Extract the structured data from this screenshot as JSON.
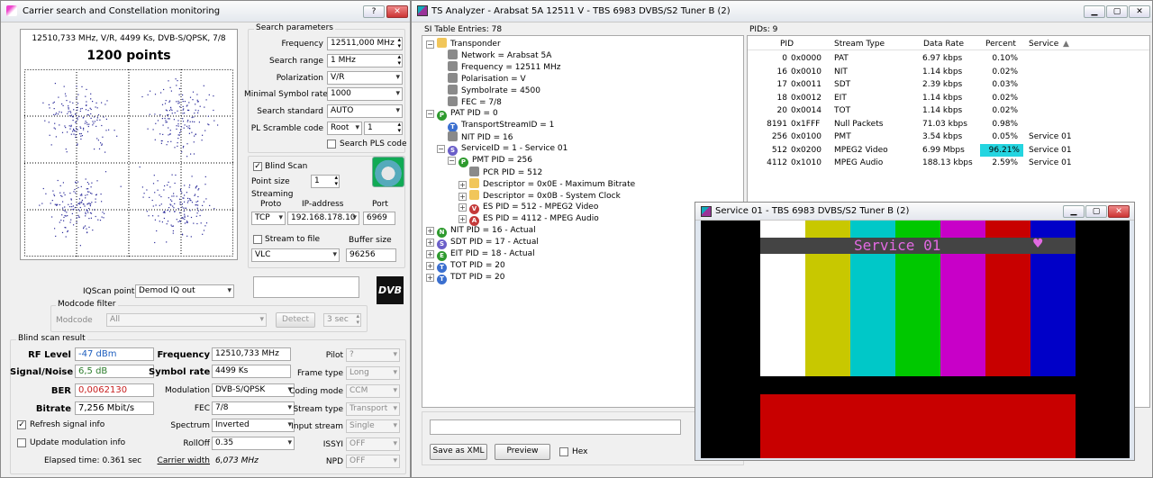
{
  "left": {
    "title": "Carrier search and Constellation monitoring",
    "constellation": {
      "info": "12510,733 MHz, V/R, 4499 Ks, DVB-S/QPSK, 7/8",
      "points": "1200 points"
    },
    "search": {
      "group": "Search parameters",
      "freq_label": "Frequency",
      "freq": "12511,000 MHz",
      "range_label": "Search range",
      "range": "1 MHz",
      "pol_label": "Polarization",
      "pol": "V/R",
      "minsr_label": "Minimal Symbol rate",
      "minsr": "1000",
      "std_label": "Search standard",
      "std": "AUTO",
      "pls_label": "PL Scramble code",
      "pls_mode": "Root",
      "pls_val": "1",
      "pls_check": "Search PLS code"
    },
    "blind": {
      "label": "Blind Scan",
      "ptsize_label": "Point size",
      "ptsize": "1",
      "streaming": "Streaming",
      "proto_h": "Proto",
      "ip_h": "IP-address",
      "port_h": "Port",
      "proto": "TCP",
      "ip": "192.168.178.10",
      "port": "6969",
      "stf_label": "Stream to file",
      "buf_label": "Buffer size",
      "player": "VLC",
      "buf": "96256"
    },
    "iq": {
      "label": "IQScan point",
      "value": "Demod IQ out",
      "modcode_group": "Modcode filter",
      "modcode_label": "Modcode",
      "modcode": "All",
      "detect": "Detect",
      "secs": "3 sec"
    },
    "result": {
      "group": "Blind scan result",
      "rf_label": "RF Level",
      "rf": "-47 dBm",
      "sn_label": "Signal/Noise",
      "sn": "6,5 dB",
      "ber_label": "BER",
      "ber": "0,0062130",
      "bitrate_label": "Bitrate",
      "bitrate": "7,256 Mbit/s",
      "freq_label": "Frequency",
      "freq": "12510,733 MHz",
      "sr_label": "Symbol rate",
      "sr": "4499 Ks",
      "mod_label": "Modulation",
      "mod": "DVB-S/QPSK",
      "fec_label": "FEC",
      "fec": "7/8",
      "spec_label": "Spectrum",
      "spec": "Inverted",
      "roll_label": "RollOff",
      "roll": "0.35",
      "cw_label": "Carrier width",
      "cw": "6,073 MHz",
      "pilot_label": "Pilot",
      "pilot": "?",
      "ft_label": "Frame type",
      "ft": "Long",
      "cm_label": "Coding mode",
      "cm": "CCM",
      "st_label": "Stream type",
      "st": "Transport",
      "is_label": "Input stream",
      "is": "Single",
      "issyi_label": "ISSYI",
      "issyi": "OFF",
      "npd_label": "NPD",
      "npd": "OFF",
      "refresh": "Refresh signal info",
      "update": "Update modulation info",
      "elapsed": "Elapsed time: 0.361 sec"
    }
  },
  "ts": {
    "title": "TS Analyzer - Arabsat 5A 12511 V - TBS 6983 DVBS/S2 Tuner B (2)",
    "si_header": "SI Table Entries: 78",
    "pids_header": "PIDs: 9",
    "tree": [
      "Transponder",
      "Network = Arabsat 5A",
      "Frequency = 12511 MHz",
      "Polarisation = V",
      "Symbolrate = 4500",
      "FEC = 7/8",
      "PAT PID = 0",
      "TransportStreamID = 1",
      "NIT PID = 16",
      "ServiceID = 1 - Service 01",
      "PMT PID = 256",
      "PCR PID = 512",
      "Descriptor = 0x0E - Maximum Bitrate",
      "Descriptor = 0x0B - System Clock",
      "ES PID = 512 - MPEG2 Video",
      "ES PID = 4112 - MPEG Audio",
      "NIT PID = 16 - Actual",
      "SDT PID = 17 - Actual",
      "EIT PID = 18 - Actual",
      "TOT PID = 20",
      "TDT PID = 20"
    ],
    "pid_cols": [
      "PID",
      "Stream Type",
      "Data Rate",
      "Percent",
      "Service"
    ],
    "pids": [
      {
        "dec": "0",
        "hex": "0x0000",
        "type": "PAT",
        "rate": "6.97 kbps",
        "pct": "0.10%",
        "svc": ""
      },
      {
        "dec": "16",
        "hex": "0x0010",
        "type": "NIT",
        "rate": "1.14 kbps",
        "pct": "0.02%",
        "svc": ""
      },
      {
        "dec": "17",
        "hex": "0x0011",
        "type": "SDT",
        "rate": "2.39 kbps",
        "pct": "0.03%",
        "svc": ""
      },
      {
        "dec": "18",
        "hex": "0x0012",
        "type": "EIT",
        "rate": "1.14 kbps",
        "pct": "0.02%",
        "svc": ""
      },
      {
        "dec": "20",
        "hex": "0x0014",
        "type": "TOT",
        "rate": "1.14 kbps",
        "pct": "0.02%",
        "svc": ""
      },
      {
        "dec": "8191",
        "hex": "0x1FFF",
        "type": "Null Packets",
        "rate": "71.03 kbps",
        "pct": "0.98%",
        "svc": ""
      },
      {
        "dec": "256",
        "hex": "0x0100",
        "type": "PMT",
        "rate": "3.54 kbps",
        "pct": "0.05%",
        "svc": "Service 01"
      },
      {
        "dec": "512",
        "hex": "0x0200",
        "type": "MPEG2 Video",
        "rate": "6.99 Mbps",
        "pct": "96.21%",
        "svc": "Service 01"
      },
      {
        "dec": "4112",
        "hex": "0x1010",
        "type": "MPEG Audio",
        "rate": "188.13 kbps",
        "pct": "2.59%",
        "svc": "Service 01"
      }
    ],
    "save_xml": "Save as XML",
    "preview": "Preview",
    "hex": "Hex"
  },
  "video": {
    "title": "Service 01 - TBS 6983 DVBS/S2 Tuner B (2)",
    "overlay": "Service 01",
    "heart": "♥",
    "bar_colors": [
      "#ffffff",
      "#c8c800",
      "#00c8c8",
      "#00c800",
      "#c800c8",
      "#c80000",
      "#0000c8",
      "#000000"
    ]
  }
}
